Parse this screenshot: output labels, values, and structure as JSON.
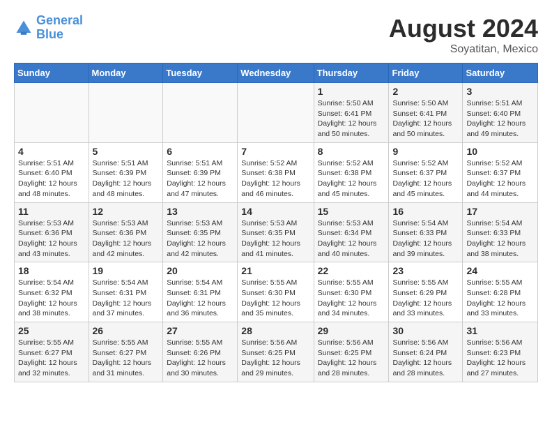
{
  "logo": {
    "text_general": "General",
    "text_blue": "Blue"
  },
  "title": {
    "month_year": "August 2024",
    "location": "Soyatitan, Mexico"
  },
  "headers": [
    "Sunday",
    "Monday",
    "Tuesday",
    "Wednesday",
    "Thursday",
    "Friday",
    "Saturday"
  ],
  "weeks": [
    [
      {
        "day": "",
        "info": ""
      },
      {
        "day": "",
        "info": ""
      },
      {
        "day": "",
        "info": ""
      },
      {
        "day": "",
        "info": ""
      },
      {
        "day": "1",
        "info": "Sunrise: 5:50 AM\nSunset: 6:41 PM\nDaylight: 12 hours\nand 50 minutes."
      },
      {
        "day": "2",
        "info": "Sunrise: 5:50 AM\nSunset: 6:41 PM\nDaylight: 12 hours\nand 50 minutes."
      },
      {
        "day": "3",
        "info": "Sunrise: 5:51 AM\nSunset: 6:40 PM\nDaylight: 12 hours\nand 49 minutes."
      }
    ],
    [
      {
        "day": "4",
        "info": "Sunrise: 5:51 AM\nSunset: 6:40 PM\nDaylight: 12 hours\nand 48 minutes."
      },
      {
        "day": "5",
        "info": "Sunrise: 5:51 AM\nSunset: 6:39 PM\nDaylight: 12 hours\nand 48 minutes."
      },
      {
        "day": "6",
        "info": "Sunrise: 5:51 AM\nSunset: 6:39 PM\nDaylight: 12 hours\nand 47 minutes."
      },
      {
        "day": "7",
        "info": "Sunrise: 5:52 AM\nSunset: 6:38 PM\nDaylight: 12 hours\nand 46 minutes."
      },
      {
        "day": "8",
        "info": "Sunrise: 5:52 AM\nSunset: 6:38 PM\nDaylight: 12 hours\nand 45 minutes."
      },
      {
        "day": "9",
        "info": "Sunrise: 5:52 AM\nSunset: 6:37 PM\nDaylight: 12 hours\nand 45 minutes."
      },
      {
        "day": "10",
        "info": "Sunrise: 5:52 AM\nSunset: 6:37 PM\nDaylight: 12 hours\nand 44 minutes."
      }
    ],
    [
      {
        "day": "11",
        "info": "Sunrise: 5:53 AM\nSunset: 6:36 PM\nDaylight: 12 hours\nand 43 minutes."
      },
      {
        "day": "12",
        "info": "Sunrise: 5:53 AM\nSunset: 6:36 PM\nDaylight: 12 hours\nand 42 minutes."
      },
      {
        "day": "13",
        "info": "Sunrise: 5:53 AM\nSunset: 6:35 PM\nDaylight: 12 hours\nand 42 minutes."
      },
      {
        "day": "14",
        "info": "Sunrise: 5:53 AM\nSunset: 6:35 PM\nDaylight: 12 hours\nand 41 minutes."
      },
      {
        "day": "15",
        "info": "Sunrise: 5:53 AM\nSunset: 6:34 PM\nDaylight: 12 hours\nand 40 minutes."
      },
      {
        "day": "16",
        "info": "Sunrise: 5:54 AM\nSunset: 6:33 PM\nDaylight: 12 hours\nand 39 minutes."
      },
      {
        "day": "17",
        "info": "Sunrise: 5:54 AM\nSunset: 6:33 PM\nDaylight: 12 hours\nand 38 minutes."
      }
    ],
    [
      {
        "day": "18",
        "info": "Sunrise: 5:54 AM\nSunset: 6:32 PM\nDaylight: 12 hours\nand 38 minutes."
      },
      {
        "day": "19",
        "info": "Sunrise: 5:54 AM\nSunset: 6:31 PM\nDaylight: 12 hours\nand 37 minutes."
      },
      {
        "day": "20",
        "info": "Sunrise: 5:54 AM\nSunset: 6:31 PM\nDaylight: 12 hours\nand 36 minutes."
      },
      {
        "day": "21",
        "info": "Sunrise: 5:55 AM\nSunset: 6:30 PM\nDaylight: 12 hours\nand 35 minutes."
      },
      {
        "day": "22",
        "info": "Sunrise: 5:55 AM\nSunset: 6:30 PM\nDaylight: 12 hours\nand 34 minutes."
      },
      {
        "day": "23",
        "info": "Sunrise: 5:55 AM\nSunset: 6:29 PM\nDaylight: 12 hours\nand 33 minutes."
      },
      {
        "day": "24",
        "info": "Sunrise: 5:55 AM\nSunset: 6:28 PM\nDaylight: 12 hours\nand 33 minutes."
      }
    ],
    [
      {
        "day": "25",
        "info": "Sunrise: 5:55 AM\nSunset: 6:27 PM\nDaylight: 12 hours\nand 32 minutes."
      },
      {
        "day": "26",
        "info": "Sunrise: 5:55 AM\nSunset: 6:27 PM\nDaylight: 12 hours\nand 31 minutes."
      },
      {
        "day": "27",
        "info": "Sunrise: 5:55 AM\nSunset: 6:26 PM\nDaylight: 12 hours\nand 30 minutes."
      },
      {
        "day": "28",
        "info": "Sunrise: 5:56 AM\nSunset: 6:25 PM\nDaylight: 12 hours\nand 29 minutes."
      },
      {
        "day": "29",
        "info": "Sunrise: 5:56 AM\nSunset: 6:25 PM\nDaylight: 12 hours\nand 28 minutes."
      },
      {
        "day": "30",
        "info": "Sunrise: 5:56 AM\nSunset: 6:24 PM\nDaylight: 12 hours\nand 28 minutes."
      },
      {
        "day": "31",
        "info": "Sunrise: 5:56 AM\nSunset: 6:23 PM\nDaylight: 12 hours\nand 27 minutes."
      }
    ]
  ]
}
